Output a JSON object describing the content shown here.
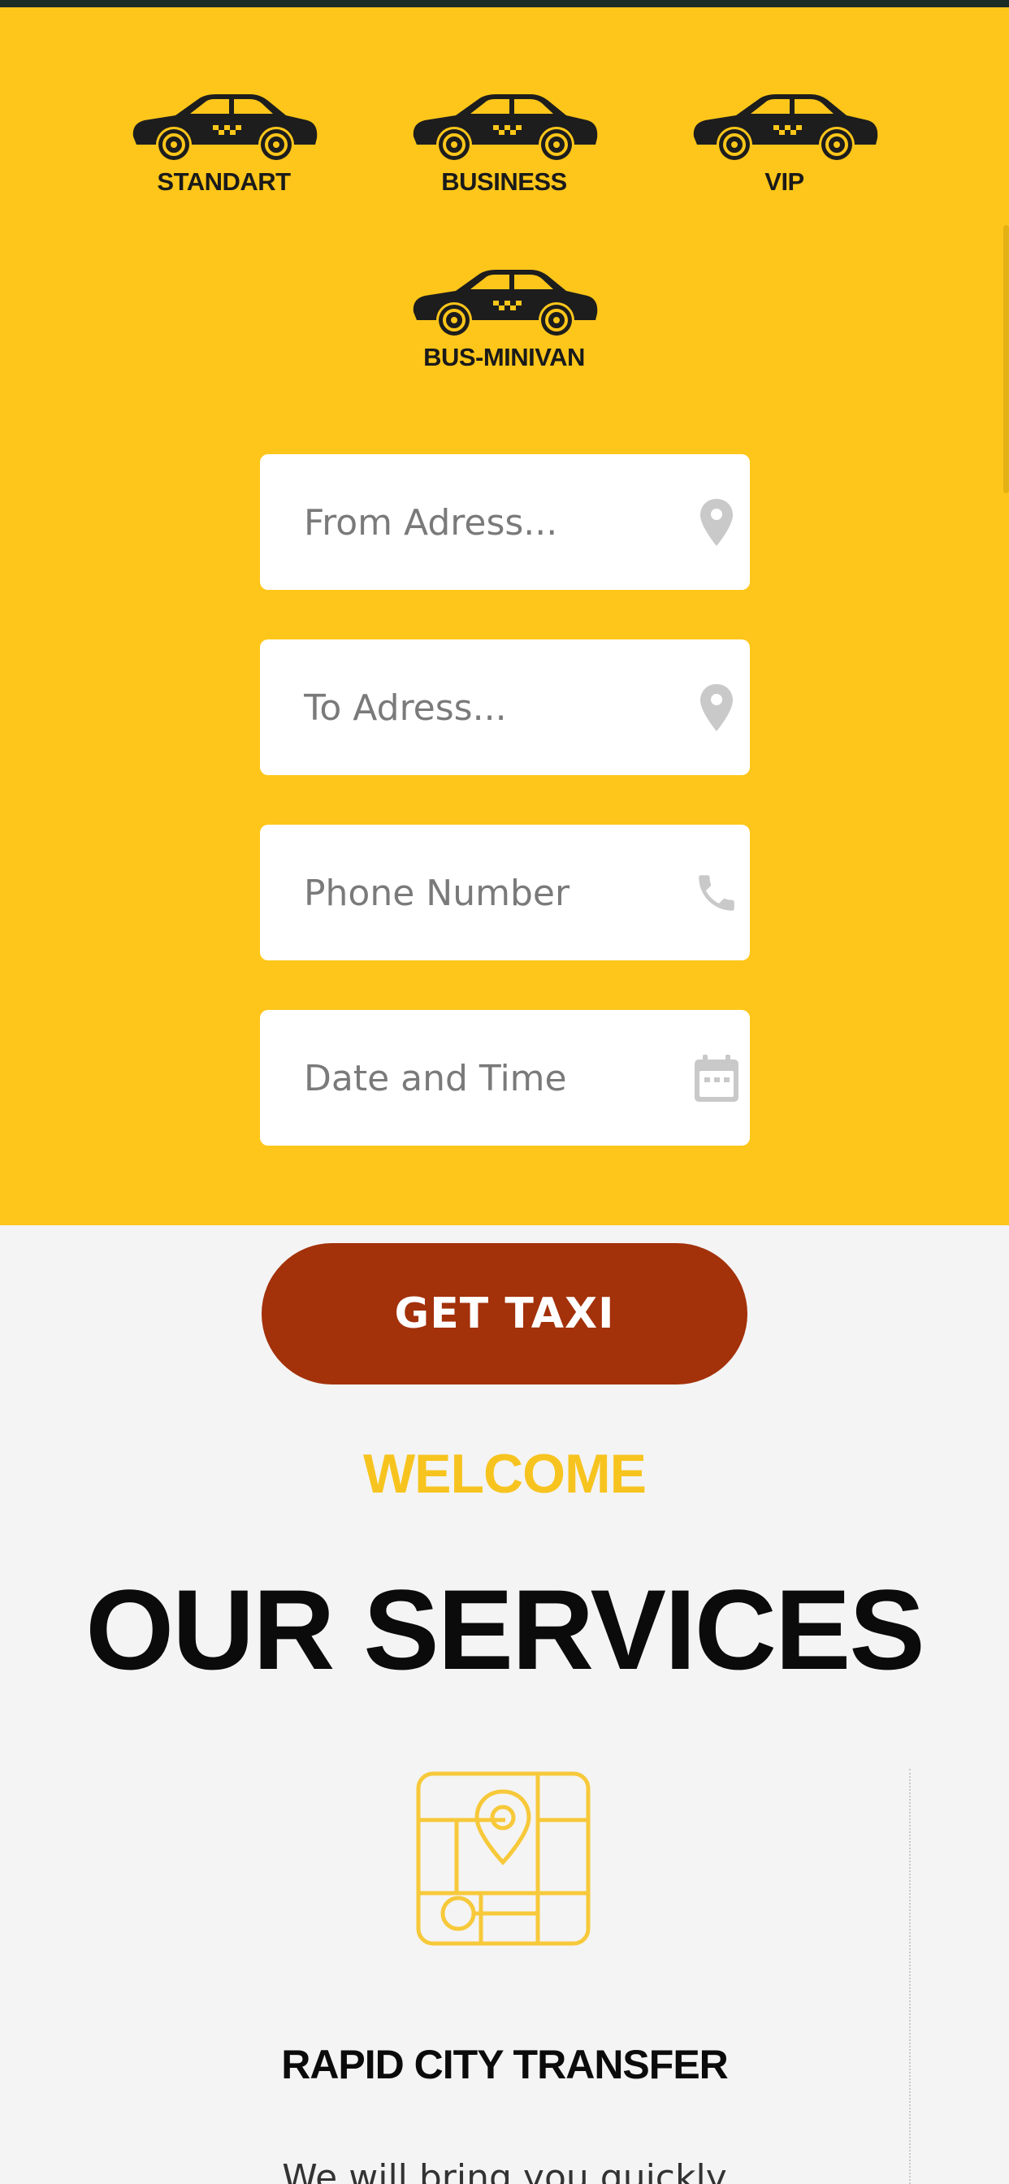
{
  "colors": {
    "yellow_band": "#fec61a",
    "button": "#a3310a",
    "welcome_accent": "#f7c41f",
    "background": "#f4f4f4",
    "icon_gray": "#c9c9c9"
  },
  "car_types": [
    {
      "label": "STANDART",
      "icon": "taxi-car-icon"
    },
    {
      "label": "BUSINESS",
      "icon": "taxi-car-icon"
    },
    {
      "label": "VIP",
      "icon": "taxi-car-icon"
    },
    {
      "label": "BUS-MINIVAN",
      "icon": "taxi-car-icon"
    }
  ],
  "form": {
    "from_placeholder": "From Adress...",
    "to_placeholder": "To Adress...",
    "phone_placeholder": "Phone Number",
    "datetime_placeholder": "Date and Time",
    "from_icon": "map-pin-icon",
    "to_icon": "map-pin-icon",
    "phone_icon": "phone-icon",
    "datetime_icon": "calendar-icon"
  },
  "cta": {
    "label": "GET TAXI"
  },
  "section": {
    "kicker": "WELCOME",
    "title": "OUR SERVICES"
  },
  "service": {
    "icon": "city-map-icon",
    "title": "RAPID CITY TRANSFER",
    "text_cut": "We will bring you quickly"
  }
}
